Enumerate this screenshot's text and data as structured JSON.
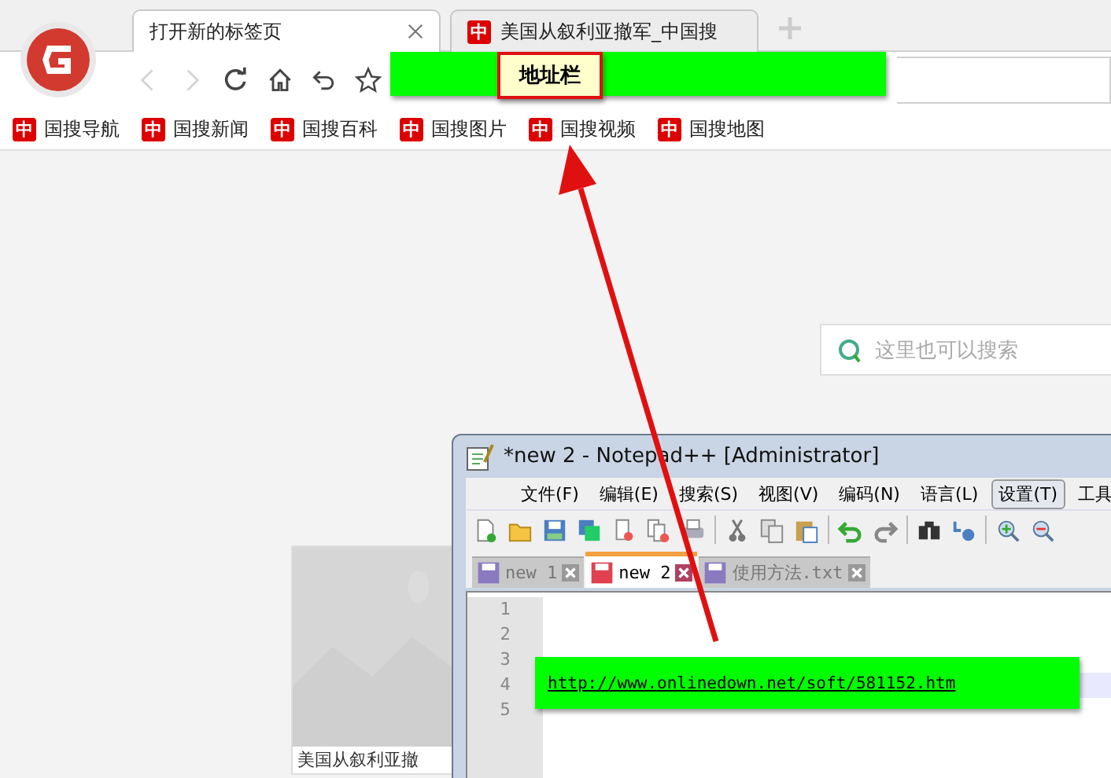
{
  "browser": {
    "tabs": [
      {
        "label": "打开新的标签页",
        "selected": true
      },
      {
        "label": "美国从叙利亚撤军_中国搜",
        "selected": false,
        "favicon": "中"
      }
    ],
    "nav": [
      {
        "kind": "back",
        "disabled": true
      },
      {
        "kind": "forward",
        "disabled": true
      },
      {
        "kind": "reload",
        "disabled": false
      },
      {
        "kind": "home",
        "disabled": false
      },
      {
        "kind": "undo",
        "disabled": false
      },
      {
        "kind": "star",
        "disabled": false
      }
    ],
    "bookmarks": [
      {
        "icon": "中",
        "label": "国搜导航"
      },
      {
        "icon": "中",
        "label": "国搜新闻"
      },
      {
        "icon": "中",
        "label": "国搜百科"
      },
      {
        "icon": "中",
        "label": "国搜图片"
      },
      {
        "icon": "中",
        "label": "国搜视频"
      },
      {
        "icon": "中",
        "label": "国搜地图"
      }
    ],
    "search": {
      "placeholder": "这里也可以搜索"
    },
    "card": {
      "caption": "美国从叙利亚撤"
    }
  },
  "notepad": {
    "title": "*new 2 - Notepad++ [Administrator]",
    "menu": [
      {
        "label": "文件(F)",
        "selected": false
      },
      {
        "label": "编辑(E)",
        "selected": false
      },
      {
        "label": "搜索(S)",
        "selected": false
      },
      {
        "label": "视图(V)",
        "selected": false
      },
      {
        "label": "编码(N)",
        "selected": false
      },
      {
        "label": "语言(L)",
        "selected": false
      },
      {
        "label": "设置(T)",
        "selected": true
      },
      {
        "label": "工具",
        "selected": false
      }
    ],
    "tabs": [
      {
        "label": "new 1",
        "selected": false
      },
      {
        "label": "new 2",
        "selected": true
      },
      {
        "label": "使用方法.txt",
        "selected": false
      }
    ],
    "lines": [
      {
        "number": "1",
        "current": false
      },
      {
        "number": "2",
        "current": false
      },
      {
        "number": "3",
        "current": false
      },
      {
        "number": "4",
        "current": true
      },
      {
        "number": "5",
        "current": false
      }
    ]
  },
  "annotations": {
    "address_label": "地址栏",
    "url": "http://www.onlinedown.net/soft/581152.htm"
  }
}
